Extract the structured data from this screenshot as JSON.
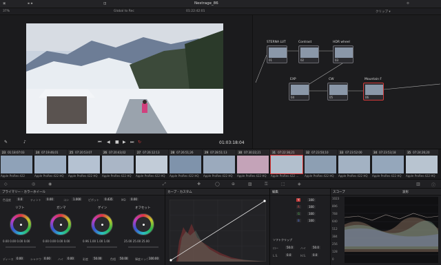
{
  "topbar": {
    "title": "Nestrage_86",
    "timecode": "01:22:42:01",
    "fit": "37%",
    "clip_name": "Global to Rec"
  },
  "viewer": {
    "timecode": "01:03:18:04"
  },
  "nodes": [
    {
      "label": "STERNA LUT",
      "num": "01"
    },
    {
      "label": "Contrast",
      "num": "02"
    },
    {
      "label": "HDR wheel",
      "num": "03"
    },
    {
      "label": "EXP",
      "num": "04"
    },
    {
      "label": "CW",
      "num": "05"
    },
    {
      "label": "Mountain F",
      "num": "06"
    }
  ],
  "clips": [
    {
      "n": "23",
      "tc": "01:18:07:03",
      "cap": "Apple ProRes 422"
    },
    {
      "n": "24",
      "tc": "07:19:46;01",
      "cap": "Apple ProRes 422 HQ"
    },
    {
      "n": "25",
      "tc": "07:20:53:07",
      "cap": "Apple ProRes 422 HQ"
    },
    {
      "n": "26",
      "tc": "07:20:43;02",
      "cap": "Apple ProRes 422 HQ"
    },
    {
      "n": "27",
      "tc": "07:26:12:13",
      "cap": "Apple ProRes 422 HQ"
    },
    {
      "n": "28",
      "tc": "07:26:51;26",
      "cap": "Apple ProRes 422 HQ"
    },
    {
      "n": "29",
      "tc": "07:28:51:13",
      "cap": "Apple ProRes 422 HQ"
    },
    {
      "n": "30",
      "tc": "07:30:22;21",
      "cap": "Apple ProRes 422 HQ"
    },
    {
      "n": "31",
      "tc": "07:22:36;21",
      "cap": "Apple ProRes 422 ..."
    },
    {
      "n": "32",
      "tc": "07:23:50;10",
      "cap": "Apple ProRes 422 HQ"
    },
    {
      "n": "33",
      "tc": "07:23:52:00",
      "cap": "Apple ProRes 422 HQ"
    },
    {
      "n": "34",
      "tc": "07:23:53;18",
      "cap": "Apple ProRes 422 HQ"
    },
    {
      "n": "35",
      "tc": "07:24:26;20",
      "cap": "Apple ProRes 422 HQ"
    }
  ],
  "colorwheels": {
    "title": "プライマリー - カラーホイール",
    "params_top": {
      "temp_label": "色温度",
      "temp": "0.0",
      "tint_label": "ティント",
      "tint": "0.00",
      "cb_label": "コン",
      "cb": "1.000",
      "piv_label": "ピボット",
      "piv": "0.435",
      "md_label": "MD",
      "md": "0.00"
    },
    "wheels": [
      {
        "name": "リフト",
        "vals": [
          "0.00",
          "0.00",
          "0.00",
          "0.00"
        ]
      },
      {
        "name": "ガンマ",
        "vals": [
          "0.00",
          "0.00",
          "0.00",
          "0.00"
        ]
      },
      {
        "name": "ゲイン",
        "vals": [
          "0.96",
          "1.00",
          "1.00",
          "1.00"
        ]
      },
      {
        "name": "オフセット",
        "vals": [
          "25.00",
          "25.00",
          "25.00",
          "25.00"
        ]
      }
    ],
    "params_bottom": {
      "a_label": "ディース",
      "a": "0.00",
      "b_label": "シャドウ",
      "b": "0.00",
      "c_label": "ハイ",
      "c": "0.00",
      "d_label": "彩度",
      "d": "50.00",
      "e_label": "色相",
      "e": "50.00",
      "f_label": "輝度ミック",
      "f": "100.00"
    }
  },
  "curves": {
    "title": "カーブ - カスタム"
  },
  "curvectl": {
    "title": "編集",
    "channels": [
      {
        "key": "Y",
        "val": "100"
      },
      {
        "key": "R",
        "val": "100"
      },
      {
        "key": "G",
        "val": "100"
      },
      {
        "key": "B",
        "val": "100"
      }
    ],
    "softclip": "ソフトクリップ",
    "low_label": "ロー",
    "low": "50.0",
    "high_label": "ハイ",
    "high": "50.0",
    "ls_label": "L.S.",
    "ls": "0.0",
    "hs_label": "H.S.",
    "hs": "0.0"
  },
  "scope": {
    "title": "スコープ",
    "mode": "波形",
    "ticks": [
      "1023",
      "896",
      "768",
      "640",
      "512",
      "384",
      "256",
      "128",
      "0"
    ]
  },
  "colors": {
    "accent_red": "#d33a3a",
    "panel": "#1e1e21"
  }
}
